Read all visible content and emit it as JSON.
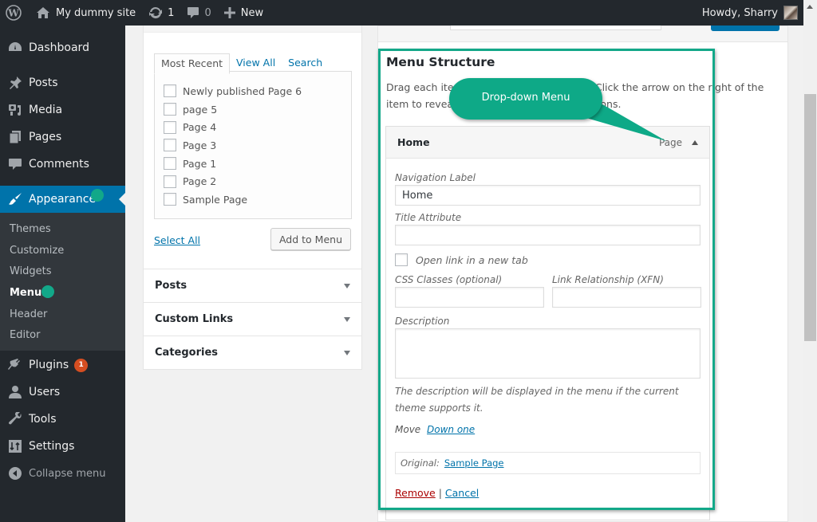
{
  "adminbar": {
    "wp_logo_icon": "wordpress-icon",
    "site_name": "My dummy site",
    "updates_count": "1",
    "comments_count": "0",
    "new_label": "New",
    "howdy": "Howdy, Sharry"
  },
  "sidebar": {
    "items_top": [
      {
        "label": "Dashboard",
        "icon": "dashboard-icon"
      },
      {
        "label": "Posts",
        "icon": "pin-icon"
      },
      {
        "label": "Media",
        "icon": "media-icon"
      },
      {
        "label": "Pages",
        "icon": "pages-icon"
      },
      {
        "label": "Comments",
        "icon": "comment-icon"
      },
      {
        "label": "Appearance",
        "icon": "paintbrush-icon",
        "active": true
      }
    ],
    "submenu": [
      {
        "label": "Themes"
      },
      {
        "label": "Customize"
      },
      {
        "label": "Widgets"
      },
      {
        "label": "Menus",
        "current": true
      },
      {
        "label": "Header"
      },
      {
        "label": "Editor"
      }
    ],
    "items_bottom": [
      {
        "label": "Plugins",
        "icon": "plugin-icon",
        "badge": "1"
      },
      {
        "label": "Users",
        "icon": "user-icon"
      },
      {
        "label": "Tools",
        "icon": "wrench-icon"
      },
      {
        "label": "Settings",
        "icon": "settings-icon"
      }
    ],
    "collapse_label": "Collapse menu"
  },
  "pages_panel": {
    "tabs": [
      "Most Recent",
      "View All",
      "Search"
    ],
    "active_tab": "Most Recent",
    "pages": [
      "Newly published Page 6",
      "page 5",
      "Page 4",
      "Page 3",
      "Page 1",
      "Page 2",
      "Sample Page"
    ],
    "select_all": "Select All",
    "add_to_menu": "Add to Menu"
  },
  "accordions": [
    "Posts",
    "Custom Links",
    "Categories"
  ],
  "menu_structure": {
    "title": "Menu Structure",
    "description": "Drag each item into the order you prefer. Click the arrow on the right of the item to reveal additional configuration options.",
    "item": {
      "title": "Home",
      "type": "Page",
      "navigation_label_label": "Navigation Label",
      "navigation_label_value": "Home",
      "title_attribute_label": "Title Attribute",
      "title_attribute_value": "",
      "open_new_tab_label": "Open link in a new tab",
      "open_new_tab_checked": false,
      "css_classes_label": "CSS Classes (optional)",
      "css_classes_value": "",
      "xfn_label": "Link Relationship (XFN)",
      "xfn_value": "",
      "description_label": "Description",
      "description_value": "",
      "description_help": "The description will be displayed in the menu if the current theme supports it.",
      "move_label": "Move",
      "move_link": "Down one",
      "original_label": "Original:",
      "original_link": "Sample Page",
      "remove_label": "Remove",
      "separator": "|",
      "cancel_label": "Cancel"
    }
  },
  "annotation": {
    "callout_text": "Drop-down Menu",
    "highlight_color": "#13a889"
  },
  "colors": {
    "admin_bar": "#23282d",
    "active_menu": "#0073aa",
    "link": "#0073aa",
    "remove": "#a00000",
    "badge": "#d54e21"
  }
}
